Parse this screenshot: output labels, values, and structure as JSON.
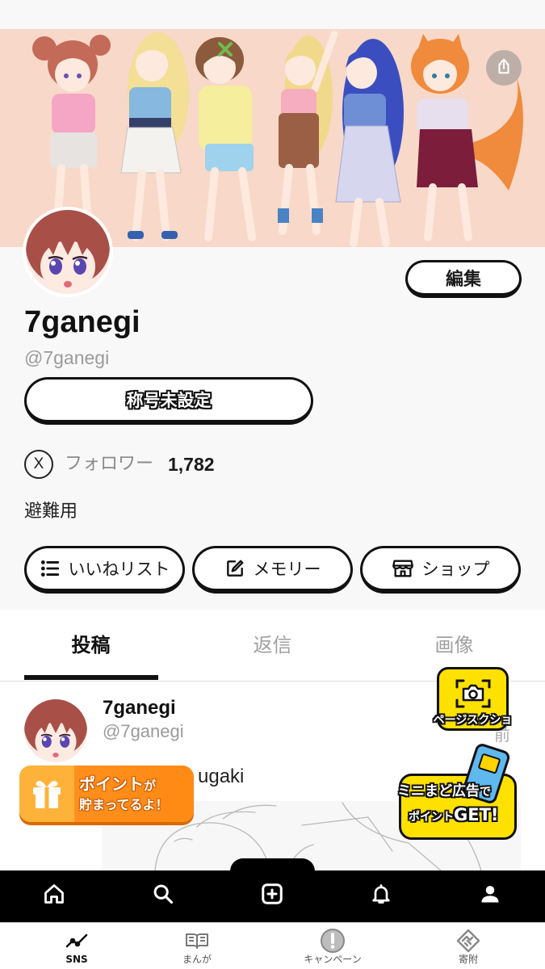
{
  "colors": {
    "banner_bg": "#f8d8c8",
    "page_bg": "#f8f8f8",
    "accent_yellow": "#ffe100",
    "points_orange": "#ff8f1c",
    "nav_bg": "#000000",
    "muted_text": "#9a9a9a"
  },
  "banner": {
    "share_icon": "share-icon"
  },
  "profile": {
    "display_name": "7ganegi",
    "handle": "@7ganegi",
    "edit_label": "編集",
    "title_label": "称号未設定",
    "x_badge": "X",
    "follower_label": "フォロワー",
    "follower_count": "1,782",
    "bio": "避難用",
    "actions": [
      {
        "label": "いいねリスト",
        "icon": "list-icon"
      },
      {
        "label": "メモリー",
        "icon": "edit-note-icon"
      },
      {
        "label": "ショップ",
        "icon": "shop-icon"
      }
    ]
  },
  "tabs": [
    {
      "label": "投稿",
      "active": true
    },
    {
      "label": "返信",
      "active": false
    },
    {
      "label": "画像",
      "active": false
    }
  ],
  "post": {
    "author_name": "7ganegi",
    "author_handle": "@7ganegi",
    "timestamp_fragment": "前",
    "text_fragment": "ugaki"
  },
  "floating": {
    "screenshot_button": {
      "label": "ページスクショ",
      "icon": "camera-icon"
    },
    "ad_badge": {
      "line1_main": "ミニまど広告",
      "line1_suffix": "で",
      "line2_main": "ポイント",
      "line2_suffix": "GET!",
      "icon": "phone-icon"
    },
    "points_banner": {
      "line1_main": "ポイント",
      "line1_suffix": "が",
      "line2": "貯まってるよ！",
      "icon": "gift-icon"
    }
  },
  "bottom_nav": {
    "items": [
      {
        "icon": "home-icon"
      },
      {
        "icon": "search-icon"
      },
      {
        "icon": "add-post-icon"
      },
      {
        "icon": "bell-icon"
      },
      {
        "icon": "profile-icon"
      }
    ]
  },
  "tab_bar": {
    "items": [
      {
        "label": "SNS",
        "icon": "trend-icon",
        "active": true
      },
      {
        "label": "まんが",
        "icon": "book-icon",
        "active": false
      },
      {
        "label": "キャンペーン",
        "icon": "exclamation-icon",
        "active": false
      },
      {
        "label": "寄附",
        "icon": "handshake-icon",
        "active": false
      }
    ]
  }
}
